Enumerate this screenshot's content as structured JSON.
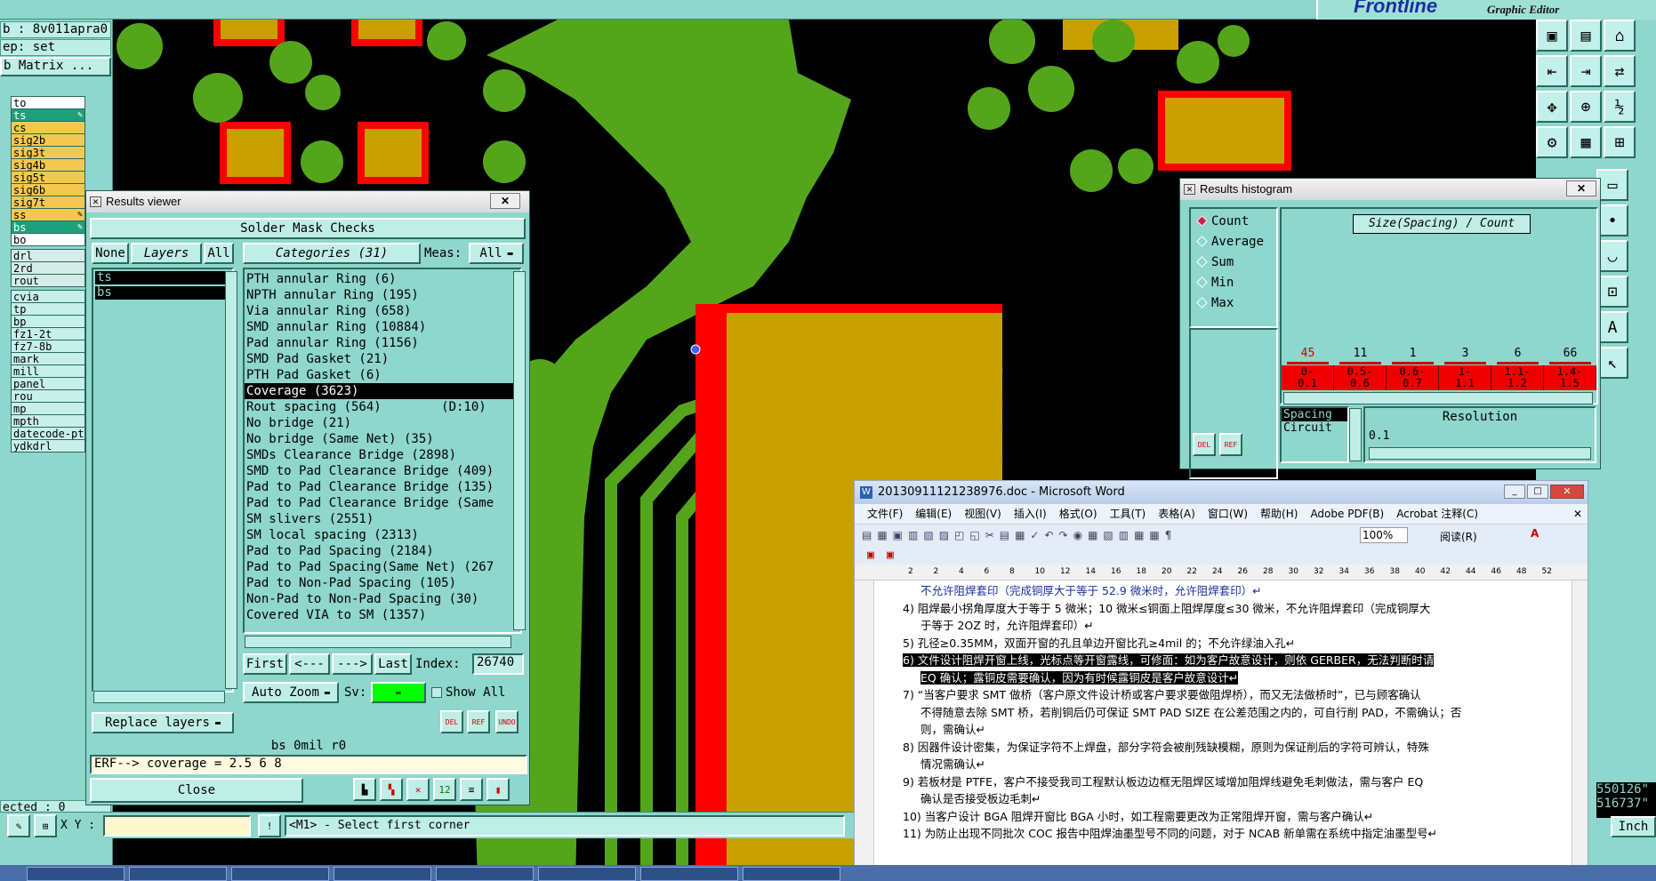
{
  "app": {
    "brand_logo": "Frontline",
    "brand_sub": "Graphic Editor"
  },
  "left_panel": {
    "job_line": "b : 8v011apra0",
    "step_line": "ep: set",
    "matrix_button": "b Matrix ...",
    "layers": [
      {
        "name": "to",
        "style": "white",
        "pin": ""
      },
      {
        "name": "ts",
        "style": "sel",
        "pin": "✎"
      },
      {
        "name": "cs",
        "style": "yellow",
        "pin": ""
      },
      {
        "name": "sig2b",
        "style": "yellow",
        "pin": ""
      },
      {
        "name": "sig3t",
        "style": "yellow",
        "pin": ""
      },
      {
        "name": "sig4b",
        "style": "yellow",
        "pin": ""
      },
      {
        "name": "sig5t",
        "style": "yellow",
        "pin": ""
      },
      {
        "name": "sig6b",
        "style": "yellow",
        "pin": ""
      },
      {
        "name": "sig7t",
        "style": "yellow",
        "pin": ""
      },
      {
        "name": "ss",
        "style": "yellow",
        "pin": "✎"
      },
      {
        "name": "bs",
        "style": "sel",
        "pin": "✎"
      },
      {
        "name": "bo",
        "style": "white",
        "pin": ""
      },
      {
        "name": "drl",
        "style": "grey",
        "pin": ""
      },
      {
        "name": "2rd",
        "style": "grey",
        "pin": ""
      },
      {
        "name": "rout",
        "style": "grey",
        "pin": ""
      },
      {
        "name": "cvia",
        "style": "cyan",
        "pin": ""
      },
      {
        "name": "tp",
        "style": "cyan",
        "pin": ""
      },
      {
        "name": "bp",
        "style": "cyan",
        "pin": ""
      },
      {
        "name": "fz1-2t",
        "style": "cyan",
        "pin": ""
      },
      {
        "name": "fz7-8b",
        "style": "cyan",
        "pin": ""
      },
      {
        "name": "mark",
        "style": "cyan",
        "pin": ""
      },
      {
        "name": "mill",
        "style": "cyan",
        "pin": ""
      },
      {
        "name": "panel",
        "style": "cyan",
        "pin": ""
      },
      {
        "name": "rou",
        "style": "cyan",
        "pin": ""
      },
      {
        "name": "mp",
        "style": "cyan",
        "pin": ""
      },
      {
        "name": "mpth",
        "style": "cyan",
        "pin": ""
      },
      {
        "name": "datecode-pt",
        "style": "cyan",
        "pin": ""
      },
      {
        "name": "ydkdrl",
        "style": "cyan",
        "pin": ""
      }
    ],
    "status": "ected : 0"
  },
  "bottom_bar": {
    "xy_label": "X Y :",
    "xy_value": "",
    "prompt": "<M1> - Select first corner"
  },
  "results_viewer": {
    "title": "Results viewer",
    "header": "Solder Mask Checks",
    "none_btn": "None",
    "layers_btn": "Layers",
    "all_btn": "All",
    "layers": [
      "ts",
      "bs"
    ],
    "categories_btn": "Categories (31)",
    "meas_label": "Meas:",
    "meas_value": "All",
    "categories": [
      "PTH annular Ring (6)",
      "NPTH annular Ring (195)",
      "Via annular Ring (658)",
      "SMD annular Ring (10884)",
      "Pad annular Ring (1156)",
      "SMD Pad Gasket (21)",
      "PTH Pad Gasket (6)",
      "Coverage (3623)",
      "Rout spacing (564)        (D:10)",
      "No bridge (21)",
      "No bridge (Same Net) (35)",
      "SMDs Clearance Bridge (2898)",
      "SMD to Pad Clearance Bridge (409)",
      "Pad to Pad Clearance Bridge (135)",
      "Pad to Pad Clearance Bridge (Same",
      "SM slivers (2551)",
      "SM local spacing (2313)",
      "Pad to Pad Spacing (2184)",
      "Pad to Pad Spacing(Same Net) (267",
      "Pad to Non-Pad Spacing (105)",
      "Non-Pad to Non-Pad Spacing (30)",
      "Covered VIA to SM (1357)"
    ],
    "selected_category": 7,
    "first_btn": "First",
    "prev_btn": "<---",
    "next_btn": "--->",
    "last_btn": "Last",
    "index_label": "Index:",
    "index_value": "26740",
    "zoom_btn": "Auto Zoom",
    "sv_label": "Sv:",
    "show_all": "Show All",
    "replace_btn": "Replace layers",
    "info_line": "bs 0mil  r0",
    "erf_line": "ERF--> coverage = 2.5 6 8",
    "close_btn": "Close",
    "del_lbl": "DEL",
    "ref_lbl": "REF",
    "undo_lbl": "UNDO"
  },
  "histogram": {
    "title": "Results histogram",
    "options": [
      "Count",
      "Average",
      "Sum",
      "Min",
      "Max"
    ],
    "selected_option": 0,
    "chart_title": "Size(Spacing) / Count",
    "counts": [
      "45",
      "11",
      "1",
      "3",
      "6",
      "66"
    ],
    "bins": [
      "0-\n0.1",
      "0.5-\n0.6",
      "0.6-\n0.7",
      "1-\n1.1",
      "1.1-\n1.2",
      "1.4-\n1.5"
    ],
    "list_items": [
      "Spacing",
      "Circuit"
    ],
    "resolution_label": "Resolution",
    "resolution_value": "0.1",
    "del_lbl": "DEL",
    "ref_lbl": "REF"
  },
  "coords": {
    "x": "550126\"",
    "y": "516737\"",
    "units": "Inch"
  },
  "word": {
    "title": "20130911121238976.doc - Microsoft Word",
    "menu": [
      "文件(F)",
      "编辑(E)",
      "视图(V)",
      "插入(I)",
      "格式(O)",
      "工具(T)",
      "表格(A)",
      "窗口(W)",
      "帮助(H)",
      "Adobe PDF(B)",
      "Acrobat 注释(C)"
    ],
    "zoom": "100%",
    "read_mode": "阅读(R)",
    "ruler_ticks": [
      "2",
      "2",
      "4",
      "6",
      "8",
      "10",
      "12",
      "14",
      "16",
      "18",
      "20",
      "22",
      "24",
      "26",
      "28",
      "30",
      "32",
      "34",
      "36",
      "38",
      "40",
      "42",
      "44",
      "46",
      "48",
      "52"
    ],
    "lines": [
      {
        "text": "不允许阻焊套印（完成铜厚大于等于 52.9 微米时，允许阻焊套印）↵",
        "cls": "blue",
        "indent": 0
      },
      {
        "text": "4)   阻焊最小拐角厚度大于等于 5 微米；10 微米≤铜面上阻焊厚度≤30 微米，不允许阻焊套印（完成铜厚大",
        "cls": "",
        "indent": -20
      },
      {
        "text": "于等于 2OZ 时，允许阻焊套印）↵",
        "cls": "",
        "indent": 0
      },
      {
        "text": "5)   孔径≥0.35MM，双面开窗的孔且单边开窗比孔≥4mil 的；不允许绿油入孔↵",
        "cls": "",
        "indent": -20
      },
      {
        "text": "6)   文件设计阻焊开窗上线，光标点等开窗露线，可修面：如为客户故意设计，则依 GERBER，无法判断时请",
        "cls": "hl",
        "indent": -20
      },
      {
        "text": "EQ 确认；露铜皮需要确认，因为有时候露铜皮是客户故意设计↵",
        "cls": "hl",
        "indent": 0
      },
      {
        "text": "7)   “当客户要求 SMT 做桥（客户原文件设计桥或客户要求要做阻焊桥），而又无法做桥时”，已与顾客确认",
        "cls": "",
        "indent": -20
      },
      {
        "text": "不得随意去除 SMT 桥，若削铜后仍可保证 SMT PAD SIZE 在公差范围之内的，可自行削 PAD，不需确认；否",
        "cls": "",
        "indent": 0
      },
      {
        "text": "则，需确认↵",
        "cls": "",
        "indent": 0
      },
      {
        "text": "8)   因器件设计密集，为保证字符不上焊盘，部分字符会被削残缺模糊，原则为保证削后的字符可辨认，特殊",
        "cls": "",
        "indent": -20
      },
      {
        "text": "情况需确认↵",
        "cls": "",
        "indent": 0
      },
      {
        "text": "9)   若板材是 PTFE，客户不接受我司工程默认板边边框无阻焊区域增加阻焊线避免毛刺做法，需与客户 EQ",
        "cls": "",
        "indent": -20
      },
      {
        "text": "确认是否接受板边毛刺↵",
        "cls": "",
        "indent": 0
      },
      {
        "text": "10) 当客户设计 BGA 阻焊开窗比 BGA 小时，如工程需要更改为正常阻焊开窗，需与客户确认↵",
        "cls": "",
        "indent": -20
      },
      {
        "text": "11) 为防止出现不同批次 COC 报告中阻焊油墨型号不同的问题，对于 NCAB 新单需在系统中指定油墨型号↵",
        "cls": "",
        "indent": -20
      }
    ]
  },
  "colors": {
    "accent": "#8fd6cc",
    "copper_green": "#55a51c",
    "pad_gold": "#c8a100",
    "mask_red": "#ff0000"
  }
}
